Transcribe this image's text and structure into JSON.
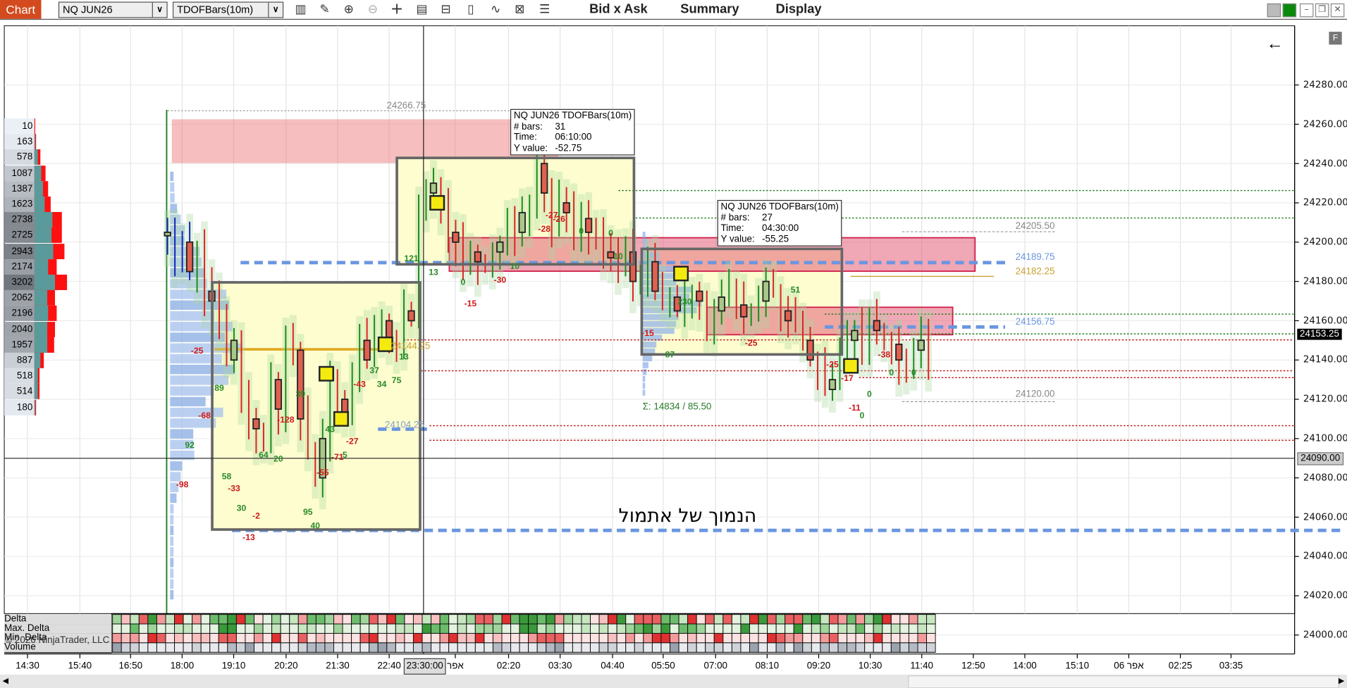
{
  "toolbar": {
    "tab_label": "Chart",
    "instrument": "NQ JUN26",
    "bar_type": "TDOFBars(10m)",
    "tools": [
      "bar-spacing-icon",
      "pencil-icon",
      "zoom-in-icon",
      "zoom-out-icon",
      "crosshair-icon",
      "data-box-icon",
      "properties-icon",
      "indicators-icon",
      "strategies-icon",
      "chart-trader-icon",
      "list-icon"
    ],
    "menus": [
      "Bid x Ask",
      "Summary",
      "Display"
    ],
    "window_buttons": [
      "gray",
      "green",
      "minimize",
      "restore",
      "close"
    ],
    "colors": {
      "tab": "#d24a1e",
      "link_green": "#0a8a0a"
    }
  },
  "price_axis": {
    "ticks": [
      "24280.00",
      "24260.00",
      "24240.00",
      "24220.00",
      "24200.00",
      "24180.00",
      "24160.00",
      "24140.00",
      "24120.00",
      "24100.00",
      "24080.00",
      "24060.00",
      "24040.00",
      "24020.00",
      "24000.00"
    ],
    "last_price": "24153.25",
    "crosshair_price": "24090.00",
    "f_button": "F",
    "back_arrow": "←"
  },
  "time_axis": {
    "labels": [
      "14:30",
      "15:40",
      "16:50",
      "18:00",
      "19:10",
      "20:20",
      "21:30",
      "22:40",
      "אפר",
      "02:20",
      "03:30",
      "04:40",
      "05:50",
      "07:00",
      "08:10",
      "09:20",
      "10:30",
      "11:40",
      "12:50",
      "14:00",
      "15:10",
      "06 אפר",
      "02:25",
      "03:35"
    ],
    "crosshair_time": "23:30:00"
  },
  "tooltips": [
    {
      "title": "NQ JUN26 TDOFBars(10m)",
      "bars_label": "# bars:",
      "bars": "31",
      "time_label": "Time:",
      "time": "06:10:00",
      "y_label": "Y value:",
      "y": "-52.75"
    },
    {
      "title": "NQ JUN26 TDOFBars(10m)",
      "bars_label": "# bars:",
      "bars": "27",
      "time_label": "Time:",
      "time": "04:30:00",
      "y_label": "Y value:",
      "y": "-55.25"
    }
  ],
  "annotations": {
    "hebrew_note": "הנמוך של אתמול",
    "sigma": "Σ: 14834 / 85.50",
    "levels": [
      {
        "text": "24266.75",
        "price": 24266.75,
        "color": "#888888"
      },
      {
        "text": "24205.50",
        "price": 24205.5,
        "color": "#888888"
      },
      {
        "text": "24189.75",
        "price": 24189.75,
        "color": "#6a96e0"
      },
      {
        "text": "24182.25",
        "price": 24182.25,
        "color": "#c8a030"
      },
      {
        "text": "24156.75",
        "price": 24156.75,
        "color": "#6a96e0"
      },
      {
        "text": "24120.00",
        "price": 24120.0,
        "color": "#888888"
      },
      {
        "text": "24104.25",
        "price": 24104.25,
        "color": "#8aa0c0"
      },
      {
        "text": "24144.25",
        "price": 24144.25,
        "color": "#c8a030"
      }
    ]
  },
  "volume_profile": {
    "volumes": [
      "10",
      "163",
      "578",
      "1087",
      "1387",
      "1623",
      "2738",
      "2725",
      "2943",
      "2174",
      "3202",
      "2062",
      "2196",
      "2040",
      "1957",
      "887",
      "518",
      "514",
      "180"
    ]
  },
  "bottom_panel": {
    "rows": [
      "Delta",
      "Max. Delta",
      "Min. Delta",
      "Volume"
    ],
    "copyright": "© 2026 NinjaTrader, LLC"
  },
  "chart_data": {
    "type": "candlestick",
    "instrument": "NQ JUN26",
    "interval": "10m",
    "ylim": [
      23995,
      24300
    ],
    "closes": [
      24205,
      24190,
      24200,
      24185,
      24195,
      24175,
      24170,
      24160,
      24140,
      24150,
      24120,
      24110,
      24105,
      24100,
      24130,
      24115,
      24150,
      24145,
      24110,
      24095,
      24080,
      24100,
      24130,
      24120,
      24110,
      24135,
      24150,
      24140,
      24155,
      24160,
      24150,
      24145,
      24165,
      24160,
      24215,
      24225,
      24230,
      24220,
      24205,
      24200,
      24190,
      24195,
      24190,
      24188,
      24195,
      24200,
      24210,
      24205,
      24215,
      24220,
      24240,
      24225,
      24210,
      24220,
      24215,
      24208,
      24212,
      24205,
      24200,
      24195,
      24192,
      24190,
      24195,
      24180,
      24185,
      24190,
      24175,
      24170,
      24172,
      24165,
      24168,
      24175,
      24170,
      24160,
      24165,
      24172,
      24175,
      24168,
      24162,
      24165,
      24170,
      24180,
      24175,
      24165,
      24160,
      24158,
      24150,
      24140,
      24135,
      24125,
      24130,
      24145,
      24150,
      24155,
      24150,
      24160,
      24155,
      24150,
      24148,
      24140,
      24135,
      24145,
      24150,
      24140
    ],
    "delta_labels": [
      [
        2,
        24077,
        "-98"
      ],
      [
        3,
        24097,
        "92"
      ],
      [
        5,
        24112,
        "-68"
      ],
      [
        4,
        24145,
        "-25"
      ],
      [
        7,
        24126,
        "89"
      ],
      [
        8,
        24081,
        "58"
      ],
      [
        9,
        24075,
        "-33"
      ],
      [
        10,
        24065,
        "30"
      ],
      [
        12,
        24061,
        "-2"
      ],
      [
        11,
        24050,
        "-13"
      ],
      [
        13,
        24092,
        "64"
      ],
      [
        15,
        24090,
        "20"
      ],
      [
        16,
        24110,
        "-128"
      ],
      [
        19,
        24063,
        "95"
      ],
      [
        20,
        24056,
        "40"
      ],
      [
        21,
        24083,
        "-55"
      ],
      [
        22,
        24105,
        "43"
      ],
      [
        23,
        24091,
        "-71"
      ],
      [
        24,
        24092,
        "5"
      ],
      [
        25,
        24099,
        "-27"
      ],
      [
        18,
        24123,
        "39"
      ],
      [
        26,
        24128,
        "-43"
      ],
      [
        28,
        24135,
        "37"
      ],
      [
        29,
        24128,
        "34"
      ],
      [
        31,
        24130,
        "75"
      ],
      [
        32,
        24142,
        "13"
      ],
      [
        33,
        24192,
        "121"
      ],
      [
        36,
        24185,
        "13"
      ],
      [
        40,
        24180,
        "0"
      ],
      [
        41,
        24169,
        "-15"
      ],
      [
        45,
        24181,
        "-30"
      ],
      [
        47,
        24188,
        "10"
      ],
      [
        51,
        24207,
        "-28"
      ],
      [
        52,
        24214,
        "-27"
      ],
      [
        53,
        24212,
        "-26"
      ],
      [
        56,
        24206,
        "0"
      ],
      [
        60,
        24205,
        "0"
      ],
      [
        61,
        24193,
        "10"
      ],
      [
        70,
        24170,
        "230"
      ],
      [
        65,
        24154,
        "-15"
      ],
      [
        68,
        24143,
        "87"
      ],
      [
        85,
        24176,
        "51"
      ],
      [
        79,
        24149,
        "-25"
      ],
      [
        90,
        24138,
        "-25"
      ],
      [
        92,
        24131,
        "-17"
      ],
      [
        93,
        24116,
        "-11"
      ],
      [
        94,
        24112,
        "0"
      ],
      [
        95,
        24123,
        "0"
      ],
      [
        97,
        24143,
        "-38"
      ],
      [
        98,
        24134,
        "0"
      ],
      [
        101,
        24134,
        "0"
      ]
    ],
    "poc_markers": [
      [
        21.5,
        24133
      ],
      [
        23.5,
        24110
      ],
      [
        29.5,
        24148
      ],
      [
        36.5,
        24220
      ],
      [
        69.5,
        24184
      ],
      [
        92.5,
        24137
      ]
    ]
  }
}
